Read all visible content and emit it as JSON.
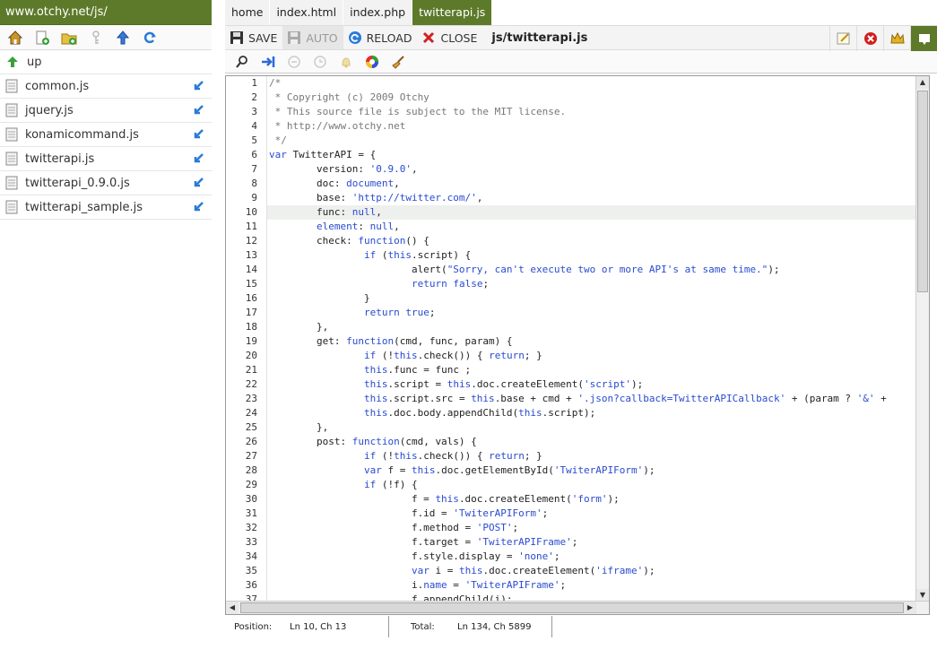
{
  "sidebar": {
    "path": "www.otchy.net/js/",
    "tools": [
      "home-icon",
      "new-file-icon",
      "new-folder-icon",
      "key-icon",
      "upload-icon",
      "refresh-icon"
    ],
    "up_label": "up",
    "files": [
      {
        "name": "common.js"
      },
      {
        "name": "jquery.js"
      },
      {
        "name": "konamicommand.js"
      },
      {
        "name": "twitterapi.js"
      },
      {
        "name": "twitterapi_0.9.0.js"
      },
      {
        "name": "twitterapi_sample.js"
      }
    ]
  },
  "tabs": [
    {
      "label": "home",
      "active": false
    },
    {
      "label": "index.html",
      "active": false
    },
    {
      "label": "index.php",
      "active": false
    },
    {
      "label": "twitterapi.js",
      "active": true
    }
  ],
  "toolbar": {
    "save": "SAVE",
    "auto": "AUTO",
    "reload": "RELOAD",
    "close": "CLOSE",
    "file_title": "js/twitterapi.js"
  },
  "status": {
    "position_label": "Position:",
    "position_value": "Ln 10, Ch 13",
    "total_label": "Total:",
    "total_value": "Ln 134, Ch 5899"
  },
  "editor": {
    "current_line": 10,
    "lines": [
      "/*",
      " * Copyright (c) 2009 Otchy",
      " * This source file is subject to the MIT license.",
      " * http://www.otchy.net",
      " */",
      "var TwitterAPI = {",
      "        version: '0.9.0',",
      "        doc: document,",
      "        base: 'http://twitter.com/',",
      "        func: null,",
      "        element: null,",
      "        check: function() {",
      "                if (this.script) {",
      "                        alert(\"Sorry, can't execute two or more API's at same time.\");",
      "                        return false;",
      "                }",
      "                return true;",
      "        },",
      "        get: function(cmd, func, param) {",
      "                if (!this.check()) { return; }",
      "                this.func = func ;",
      "                this.script = this.doc.createElement('script');",
      "                this.script.src = this.base + cmd + '.json?callback=TwitterAPICallback' + (param ? '&' +",
      "                this.doc.body.appendChild(this.script);",
      "        },",
      "        post: function(cmd, vals) {",
      "                if (!this.check()) { return; }",
      "                var f = this.doc.getElementById('TwiterAPIForm');",
      "                if (!f) {",
      "                        f = this.doc.createElement('form');",
      "                        f.id = 'TwiterAPIForm';",
      "                        f.method = 'POST';",
      "                        f.target = 'TwiterAPIFrame';",
      "                        f.style.display = 'none';",
      "                        var i = this.doc.createElement('iframe');",
      "                        i.name = 'TwiterAPIFrame';",
      "                        f.appendChild(i);"
    ]
  }
}
